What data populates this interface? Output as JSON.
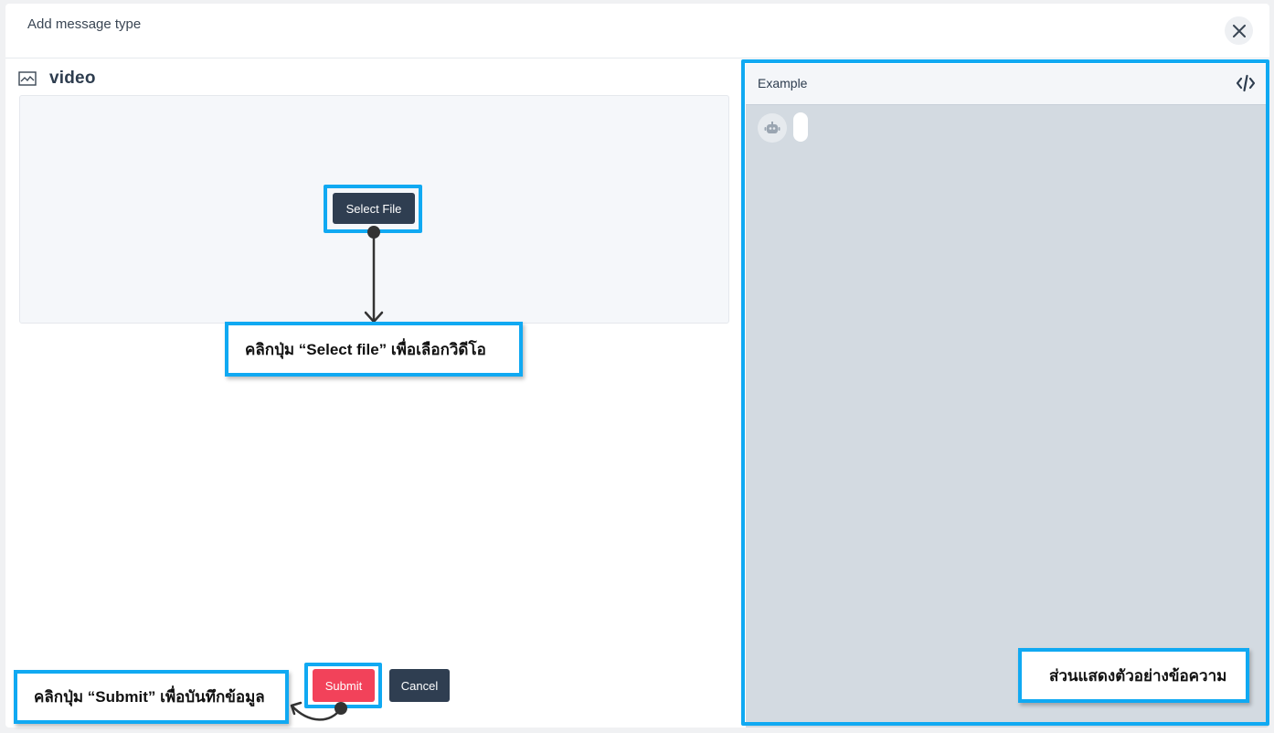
{
  "dialog": {
    "title": "Add message type"
  },
  "section": {
    "icon": "image-icon",
    "title": "video"
  },
  "upload": {
    "select_label": "Select File"
  },
  "actions": {
    "submit_label": "Submit",
    "cancel_label": "Cancel"
  },
  "preview": {
    "title": "Example",
    "code_icon": "code-icon",
    "avatar_icon": "robot-icon"
  },
  "annotations": {
    "select_hint": "คลิกปุ่ม “Select file” เพื่อเลือกวิดีโอ",
    "submit_hint": "คลิกปุ่ม “Submit” เพื่อบันทึกข้อมูล",
    "preview_hint": "ส่วนแสดงตัวอย่างข้อความ"
  },
  "colors": {
    "highlight": "#10a9f2",
    "primary_dark": "#2f3e51",
    "submit_red": "#f2425a",
    "preview_bg": "#d3dae1"
  }
}
